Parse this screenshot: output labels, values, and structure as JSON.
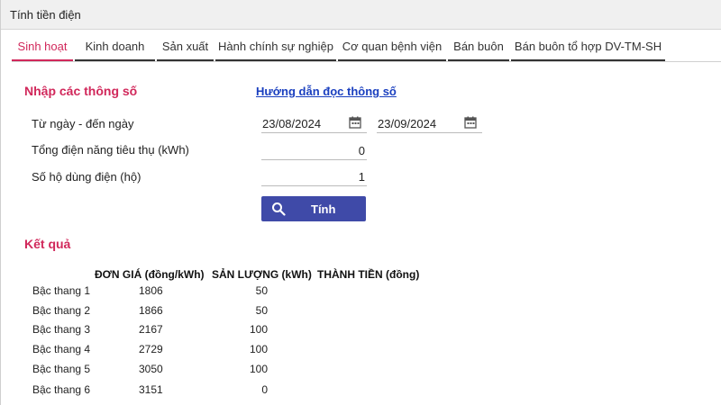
{
  "window": {
    "title": "Tính tiền điện"
  },
  "tabs": [
    {
      "label": "Sinh hoạt",
      "active": true
    },
    {
      "label": "Kinh doanh"
    },
    {
      "label": "Sản xuất"
    },
    {
      "label": "Hành chính sự nghiệp"
    },
    {
      "label": "Cơ quan bệnh viện"
    },
    {
      "label": "Bán buôn"
    },
    {
      "label": "Bán buôn tổ hợp DV-TM-SH"
    }
  ],
  "form": {
    "title": "Nhập các thông số",
    "guide_link": "Hướng dẫn đọc thông số",
    "date_label": "Từ ngày - đến ngày",
    "from_date": "23/08/2024",
    "to_date": "23/09/2024",
    "kwh_label": "Tổng điện năng tiêu thụ (kWh)",
    "kwh_value": "0",
    "households_label": "Số hộ dùng điện (hộ)",
    "households_value": "1",
    "calc_button": "Tính"
  },
  "result": {
    "title": "Kết quả",
    "headers": [
      "ĐƠN GIÁ (đồng/kWh)",
      "SẢN LƯỢNG (kWh)",
      "THÀNH TIỀN (đồng)"
    ],
    "rows": [
      {
        "tier": "Bậc thang 1",
        "price": "1806",
        "qty": "50"
      },
      {
        "tier": "Bậc thang 2",
        "price": "1866",
        "qty": "50"
      },
      {
        "tier": "Bậc thang 3",
        "price": "2167",
        "qty": "100"
      },
      {
        "tier": "Bậc thang 4",
        "price": "2729",
        "qty": "100"
      },
      {
        "tier": "Bậc thang 5",
        "price": "3050",
        "qty": "100"
      },
      {
        "tier": "Bậc thang 6",
        "price": "3151",
        "qty": "0"
      }
    ]
  },
  "icons": {
    "calendar": "calendar-icon",
    "search": "search-icon"
  },
  "colors": {
    "accent": "#d1285b",
    "button": "#3f4aa8",
    "link": "#1a3fbf"
  }
}
